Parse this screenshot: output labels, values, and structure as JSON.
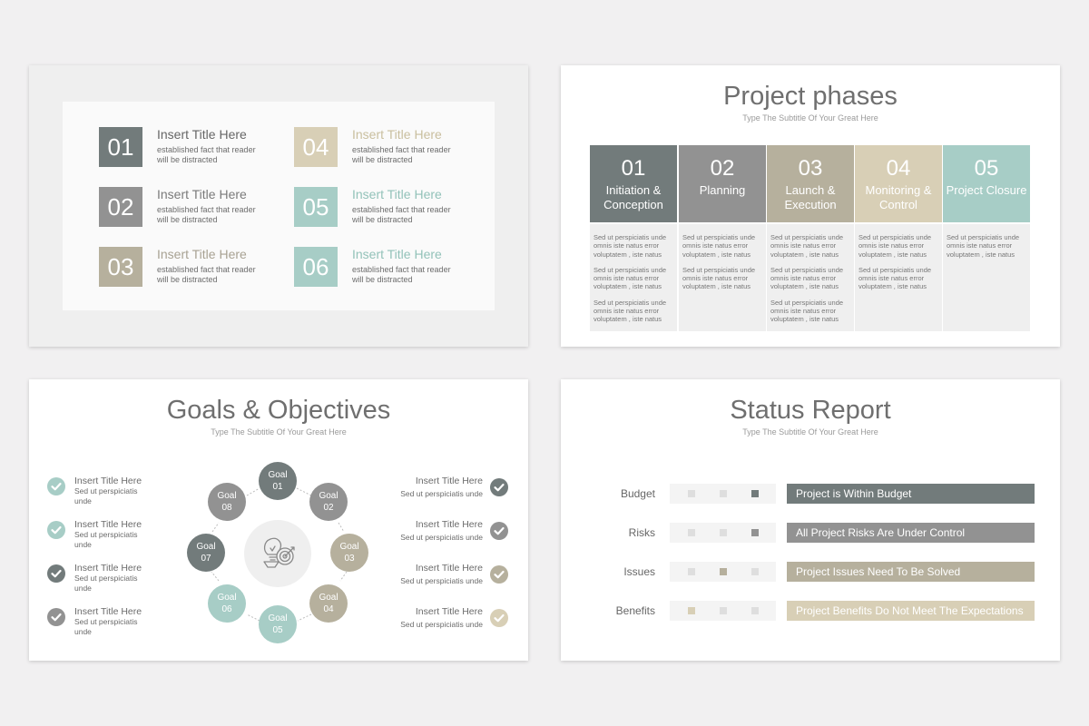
{
  "colors": {
    "c1": "#727b7b",
    "c2": "#929292",
    "c3": "#b6b09d",
    "c4": "#d8cfb6",
    "c5": "#a7cdc6",
    "page_bg": "#f1f0f1",
    "dot_light": "#dedede"
  },
  "slide1": {
    "items": [
      {
        "num": "01",
        "title": "Insert Title Here",
        "desc": "established fact that reader will be distracted"
      },
      {
        "num": "02",
        "title": "Insert Title Here",
        "desc": "established fact that reader will be distracted"
      },
      {
        "num": "03",
        "title": "Insert Title Here",
        "desc": "established fact that reader will be distracted"
      },
      {
        "num": "04",
        "title": "Insert Title Here",
        "desc": "established fact that reader will be distracted"
      },
      {
        "num": "05",
        "title": "Insert Title Here",
        "desc": "established fact that reader will be distracted"
      },
      {
        "num": "06",
        "title": "Insert Title Here",
        "desc": "established fact that reader will be distracted"
      }
    ]
  },
  "slide2": {
    "title": "Project phases",
    "subtitle": "Type The Subtitle Of Your Great Here",
    "phases": [
      {
        "num": "01",
        "label": "Initiation & Conception",
        "paragraphs": [
          "Sed ut perspiciatis unde omnis iste natus error voluptatem , iste natus",
          "Sed ut perspiciatis unde omnis iste natus error voluptatem , iste natus",
          "Sed ut perspiciatis unde omnis iste natus error voluptatem , iste natus"
        ]
      },
      {
        "num": "02",
        "label": "Planning",
        "paragraphs": [
          "Sed ut perspiciatis unde omnis iste natus error voluptatem , iste natus",
          "Sed ut perspiciatis unde omnis iste natus error voluptatem , iste natus"
        ]
      },
      {
        "num": "03",
        "label": "Launch & Execution",
        "paragraphs": [
          "Sed ut perspiciatis unde omnis iste natus error voluptatem , iste natus",
          "Sed ut perspiciatis unde omnis iste natus error voluptatem , iste natus",
          "Sed ut perspiciatis unde omnis iste natus error voluptatem , iste natus"
        ]
      },
      {
        "num": "04",
        "label": "Monitoring & Control",
        "paragraphs": [
          "Sed ut perspiciatis unde omnis iste natus error voluptatem , iste natus",
          "Sed ut perspiciatis unde omnis iste natus error voluptatem , iste natus"
        ]
      },
      {
        "num": "05",
        "label": "Project Closure",
        "paragraphs": [
          "Sed ut perspiciatis unde omnis iste natus error voluptatem , iste natus"
        ]
      }
    ]
  },
  "slide3": {
    "title": "Goals & Objectives",
    "subtitle": "Type The Subtitle Of Your Great Here",
    "left_items": [
      {
        "title": "Insert Title Here",
        "desc": "Sed ut perspiciatis unde"
      },
      {
        "title": "Insert Title Here",
        "desc": "Sed ut perspiciatis unde"
      },
      {
        "title": "Insert Title Here",
        "desc": "Sed ut perspiciatis unde"
      },
      {
        "title": "Insert Title Here",
        "desc": "Sed ut perspiciatis unde"
      }
    ],
    "right_items": [
      {
        "title": "Insert Title Here",
        "desc": "Sed ut perspiciatis unde"
      },
      {
        "title": "Insert Title Here",
        "desc": "Sed ut perspiciatis unde"
      },
      {
        "title": "Insert Title Here",
        "desc": "Sed ut perspiciatis unde"
      },
      {
        "title": "Insert Title Here",
        "desc": "Sed ut perspiciatis unde"
      }
    ],
    "goals": [
      {
        "word": "Goal",
        "num": "01"
      },
      {
        "word": "Goal",
        "num": "02"
      },
      {
        "word": "Goal",
        "num": "03"
      },
      {
        "word": "Goal",
        "num": "04"
      },
      {
        "word": "Goal",
        "num": "05"
      },
      {
        "word": "Goal",
        "num": "06"
      },
      {
        "word": "Goal",
        "num": "07"
      },
      {
        "word": "Goal",
        "num": "08"
      }
    ],
    "hub_icon": "lightbulb-target-icon"
  },
  "slide4": {
    "title": "Status Report",
    "subtitle": "Type The Subtitle Of Your Great Here",
    "rows": [
      {
        "label": "Budget",
        "status": "Project is Within Budget",
        "active_dot": 3
      },
      {
        "label": "Risks",
        "status": "All Project Risks Are Under Control",
        "active_dot": 3
      },
      {
        "label": "Issues",
        "status": "Project Issues Need To Be Solved",
        "active_dot": 2
      },
      {
        "label": "Benefits",
        "status": "Project Benefits Do Not Meet The Expectations",
        "active_dot": 1
      }
    ]
  }
}
